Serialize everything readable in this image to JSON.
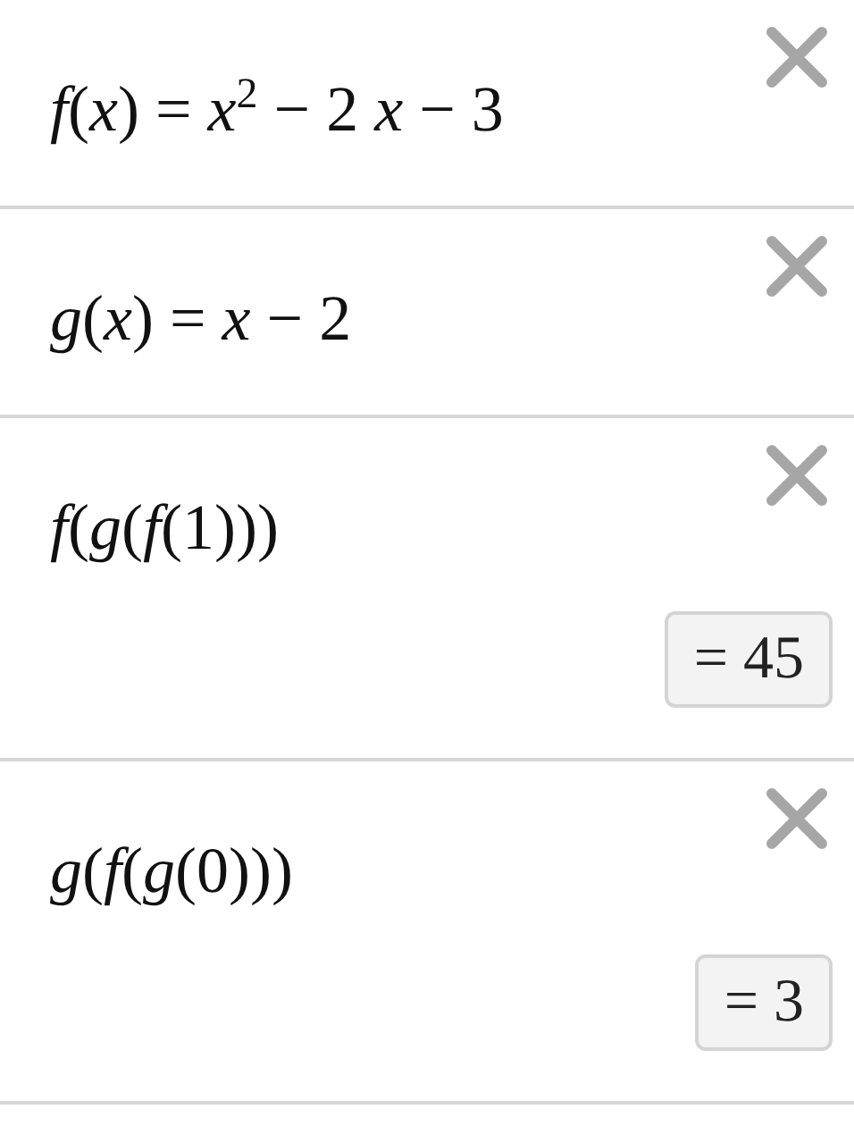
{
  "expressions": [
    {
      "expression": "*f*(*x*) = *x*$^{2}$ − 2 *x* − 3"
    },
    {
      "expression": "*g*(*x*) = *x* − 2"
    },
    {
      "expression": "*f*(*g*(*f*(1)))",
      "result": "= 45"
    },
    {
      "expression": "*g*(*f*(*g*(0)))",
      "result": "= 3"
    }
  ]
}
